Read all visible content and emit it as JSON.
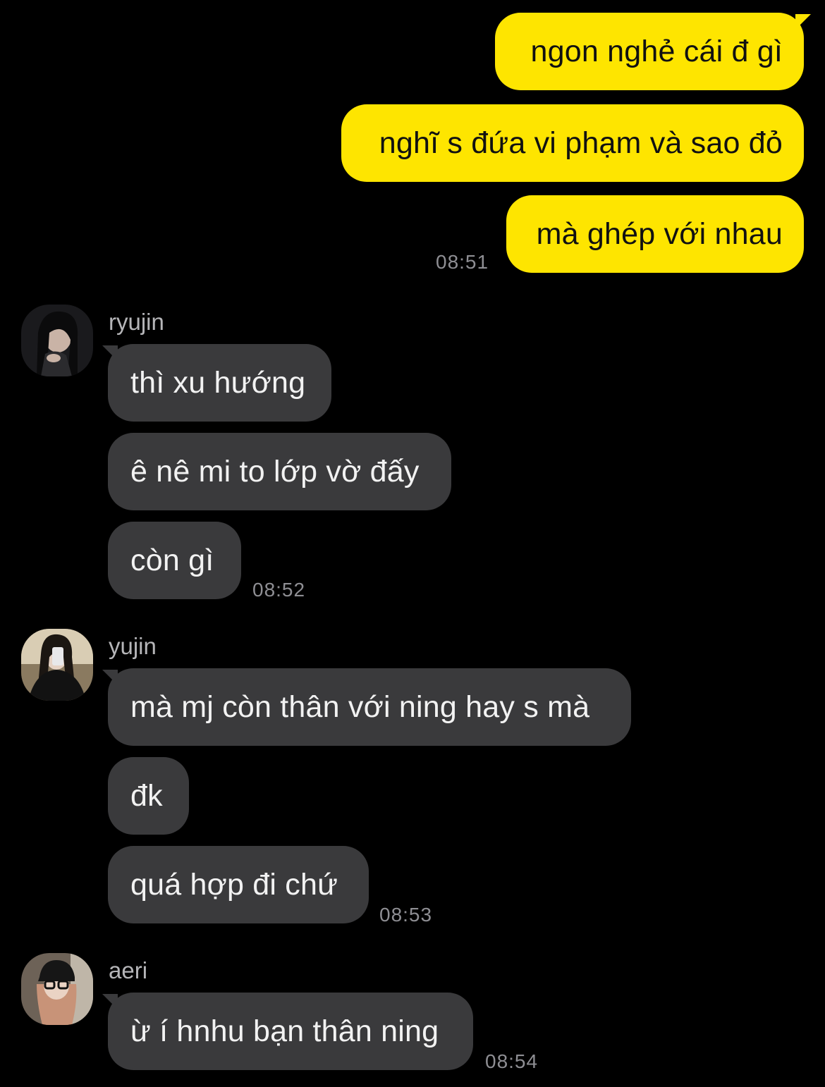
{
  "colors": {
    "background": "#000000",
    "outgoing_bubble": "#FEE500",
    "incoming_bubble": "#3A3A3C",
    "timestamp": "#8E8E93",
    "sender_name": "#B5B5B8"
  },
  "outgoing": {
    "messages": [
      {
        "text": "ngon nghẻ cái đ gì"
      },
      {
        "text": "nghĩ s đứa vi phạm và sao đỏ"
      },
      {
        "text": "mà ghép với nhau"
      }
    ],
    "time": "08:51"
  },
  "groups": [
    {
      "sender": "ryujin",
      "avatar_icon": "profile-photo-icon",
      "messages": [
        {
          "text": "thì xu hướng"
        },
        {
          "text": "ê nê mi to lớp vờ đấy"
        },
        {
          "text": "còn gì"
        }
      ],
      "time": "08:52"
    },
    {
      "sender": "yujin",
      "avatar_icon": "profile-photo-icon",
      "messages": [
        {
          "text": "mà mj còn thân với ning hay s mà"
        },
        {
          "text": "đk"
        },
        {
          "text": "quá hợp đi chứ"
        }
      ],
      "time": "08:53"
    },
    {
      "sender": "aeri",
      "avatar_icon": "profile-photo-icon",
      "messages": [
        {
          "text": "ừ í hnhu bạn thân ning"
        }
      ],
      "time": "08:54"
    }
  ]
}
